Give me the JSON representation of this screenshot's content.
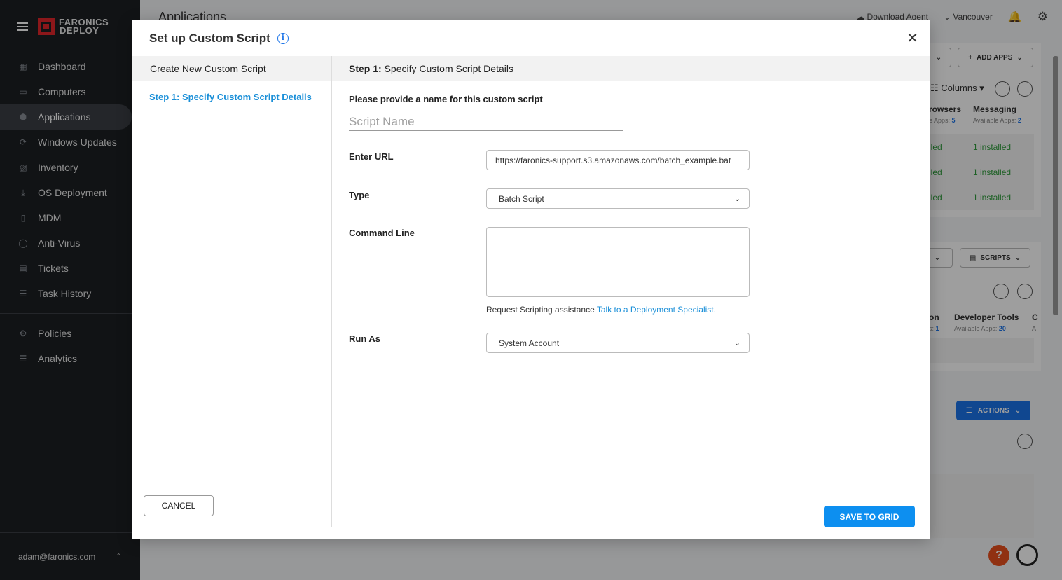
{
  "app": {
    "logo_line1": "FARONICS",
    "logo_line2": "DEPLOY",
    "user_email": "adam@faronics.com"
  },
  "sidebar": {
    "items": [
      {
        "label": "Dashboard",
        "icon": "dashboard-icon"
      },
      {
        "label": "Computers",
        "icon": "computer-icon"
      },
      {
        "label": "Applications",
        "icon": "cube-icon",
        "active": true
      },
      {
        "label": "Windows Updates",
        "icon": "refresh-icon"
      },
      {
        "label": "Inventory",
        "icon": "clipboard-icon"
      },
      {
        "label": "OS Deployment",
        "icon": "download-icon"
      },
      {
        "label": "MDM",
        "icon": "phone-icon"
      },
      {
        "label": "Anti-Virus",
        "icon": "shield-icon"
      },
      {
        "label": "Tickets",
        "icon": "ticket-icon"
      },
      {
        "label": "Task History",
        "icon": "list-icon"
      }
    ],
    "items2": [
      {
        "label": "Policies",
        "icon": "gear-icon"
      },
      {
        "label": "Analytics",
        "icon": "list-icon"
      }
    ]
  },
  "background": {
    "page_title": "Applications",
    "download_agent": "Download Agent",
    "location": "Vancouver",
    "add_apps": "ADD APPS",
    "columns": "Columns",
    "scripts": "SCRIPTS",
    "actions": "ACTIONS",
    "col_browsers": "rowsers",
    "col_browsers_sub": "e Apps:",
    "col_browsers_count": "5",
    "col_messaging": "Messaging",
    "col_messaging_sub": "Available Apps:",
    "col_messaging_count": "2",
    "col_partial_a": "lled",
    "installed_text": "1 installed",
    "col_on": "on",
    "col_on_sub": "s:",
    "col_on_count": "1",
    "col_devtools": "Developer Tools",
    "col_devtools_sub": "Available Apps:",
    "col_devtools_count": "20",
    "col_edge": "C",
    "col_edge_sub": "A",
    "help": "?"
  },
  "modal": {
    "title": "Set up Custom Script",
    "left_header": "Create New Custom Script",
    "step_link": "Step 1: Specify Custom Script Details",
    "right_header_bold": "Step 1:",
    "right_header_rest": "Specify Custom Script Details",
    "name_prompt": "Please provide a name for this custom script",
    "script_name_placeholder": "Script Name",
    "url_label": "Enter URL",
    "url_value": "https://faronics-support.s3.amazonaws.com/batch_example.bat",
    "type_label": "Type",
    "type_value": "Batch Script",
    "cmd_label": "Command Line",
    "cmd_value": "",
    "help_text": "Request Scripting assistance",
    "help_link": "Talk to a Deployment Specialist.",
    "runas_label": "Run As",
    "runas_value": "System Account",
    "cancel": "CANCEL",
    "save": "SAVE TO GRID"
  }
}
